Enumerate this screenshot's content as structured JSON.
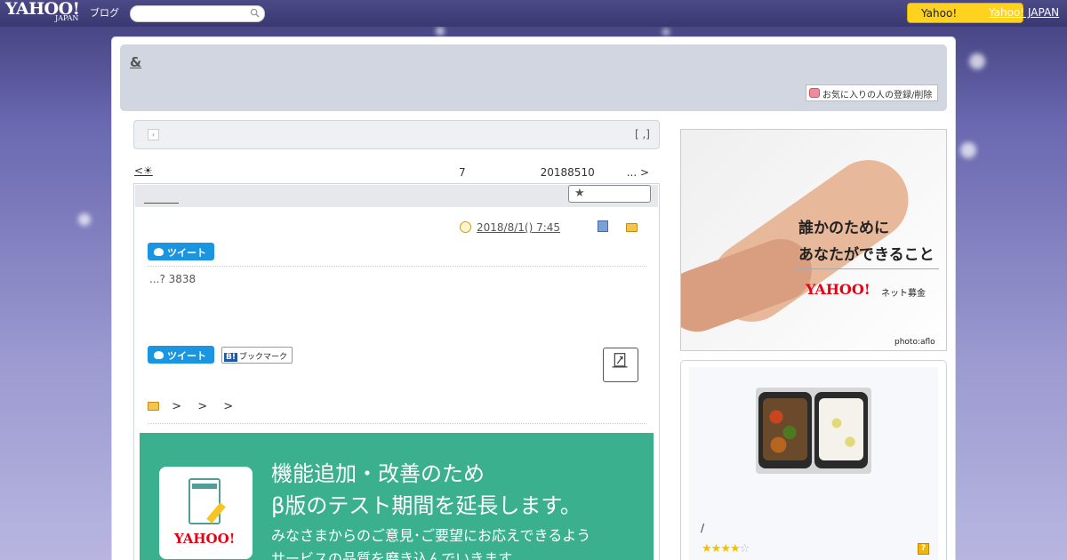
{
  "masthead": {
    "logo_text": "YAHOO!",
    "logo_sub": "JAPAN",
    "blog_label": "ブログ",
    "search": {
      "placeholder": "",
      "value": ""
    },
    "yahoo_button_label": "Yahoo!",
    "top_link": "Yahoo! JAPAN"
  },
  "blog": {
    "title": "&",
    "favorite_button": "お気に入りの人の登録/削除"
  },
  "notice": {
    "text": "[ ,]"
  },
  "pager": {
    "prev_text": "<☀",
    "next_text": "7　　　　　　　20188510　　　... >"
  },
  "article": {
    "date": "2018/8/1()  7:45",
    "tweet_label": "ツイート",
    "body": "...? 3838",
    "bookmark_label": "ブックマーク",
    "bookmark_badge": "B!",
    "breadcrumbs": [
      ">",
      ">",
      ">"
    ]
  },
  "promo": {
    "line1": "機能追加・改善のため",
    "line2": "β版のテスト期間を延長します。",
    "line3": "みなさまからのご意見･ご要望にお応えできるよう",
    "line4": "サービスの品質を磨き込んでいきます",
    "logo": "YAHOO!"
  },
  "ad": {
    "line1": "誰かのために",
    "line2": "あなたができること",
    "logo": "YAHOO!",
    "logo_sub": "ネット募金",
    "credit": "photo:aflo"
  },
  "side_panel": {
    "caption": "/",
    "rating": {
      "value": 4,
      "max": 5
    },
    "help_glyph": "?"
  },
  "colors": {
    "masthead": "#3a3872",
    "header_box": "#d1d6e1",
    "tweet": "#1b95e0",
    "promo": "#3bb08f",
    "yahoo_button": "#ffd21f"
  }
}
